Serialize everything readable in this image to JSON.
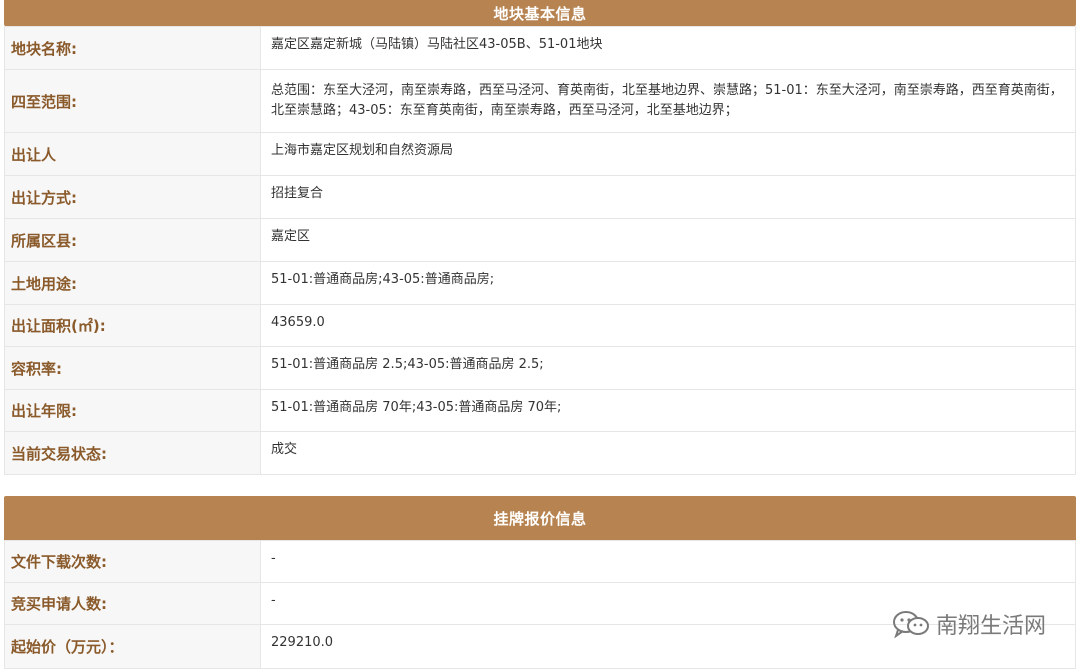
{
  "basic_info": {
    "title": "地块基本信息",
    "rows": [
      {
        "label": "地块名称:",
        "value": "嘉定区嘉定新城（马陆镇）马陆社区43-05B、51-01地块"
      },
      {
        "label": "四至范围:",
        "value": "总范围：东至大泾河，南至崇寿路，西至马泾河、育英南街，北至基地边界、崇慧路；51-01：东至大泾河，南至崇寿路，西至育英南街，北至崇慧路；43-05：东至育英南街，南至崇寿路，西至马泾河，北至基地边界；"
      },
      {
        "label": "出让人",
        "value": "上海市嘉定区规划和自然资源局"
      },
      {
        "label": "出让方式:",
        "value": "招挂复合"
      },
      {
        "label": "所属区县:",
        "value": "嘉定区"
      },
      {
        "label": "土地用途:",
        "value": "51-01:普通商品房;43-05:普通商品房;"
      },
      {
        "label": "出让面积(㎡):",
        "value": "43659.0"
      },
      {
        "label": "容积率:",
        "value": "51-01:普通商品房 2.5;43-05:普通商品房 2.5;"
      },
      {
        "label": "出让年限:",
        "value": "51-01:普通商品房 70年;43-05:普通商品房 70年;"
      },
      {
        "label": "当前交易状态:",
        "value": "成交"
      }
    ]
  },
  "listing_info": {
    "title": "挂牌报价信息",
    "rows": [
      {
        "label": "文件下载次数:",
        "value": "-"
      },
      {
        "label": "竞买申请人数:",
        "value": "-"
      },
      {
        "label": "起始价（万元）：",
        "value": "229210.0"
      }
    ]
  },
  "watermark": {
    "text": "南翔生活网",
    "icon": "wechat-icon"
  }
}
